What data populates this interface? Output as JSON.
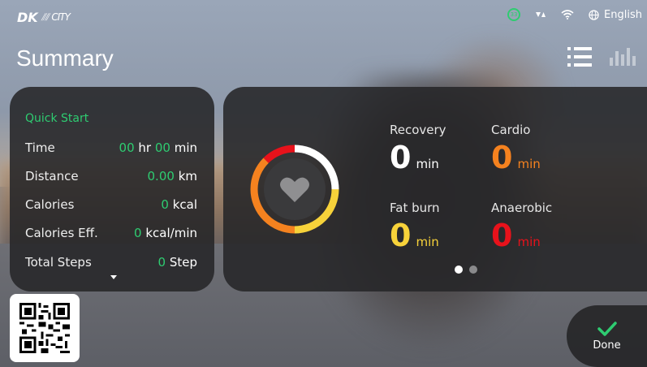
{
  "status_bar": {
    "logo_text": "DK",
    "logo_sub": "CITY",
    "badge_value": "33",
    "language": "English"
  },
  "page": {
    "title": "Summary"
  },
  "quick_start": {
    "heading": "Quick Start",
    "rows": [
      {
        "label": "Time",
        "parts": [
          "00",
          " hr ",
          "00",
          " min"
        ]
      },
      {
        "label": "Distance",
        "value": "0.00",
        "unit": " km"
      },
      {
        "label": "Calories",
        "value": "0",
        "unit": " kcal"
      },
      {
        "label": "Calories Eff.",
        "value": "0",
        "unit": " kcal/min"
      },
      {
        "label": "Total Steps",
        "value": "0",
        "unit": " Step"
      }
    ]
  },
  "heart_zones": {
    "metrics": [
      {
        "label": "Recovery",
        "value": "0",
        "unit": "min",
        "color": "#ffffff"
      },
      {
        "label": "Cardio",
        "value": "0",
        "unit": "min",
        "color": "#f5821f"
      },
      {
        "label": "Fat burn",
        "value": "0",
        "unit": "min",
        "color": "#f7d23a"
      },
      {
        "label": "Anaerobic",
        "value": "0",
        "unit": "min",
        "color": "#e8121b"
      }
    ],
    "page_index": 1,
    "page_count": 2
  },
  "done_button": {
    "label": "Done"
  },
  "colors": {
    "accent_green": "#2ecc71",
    "card_bg": "#262628"
  }
}
